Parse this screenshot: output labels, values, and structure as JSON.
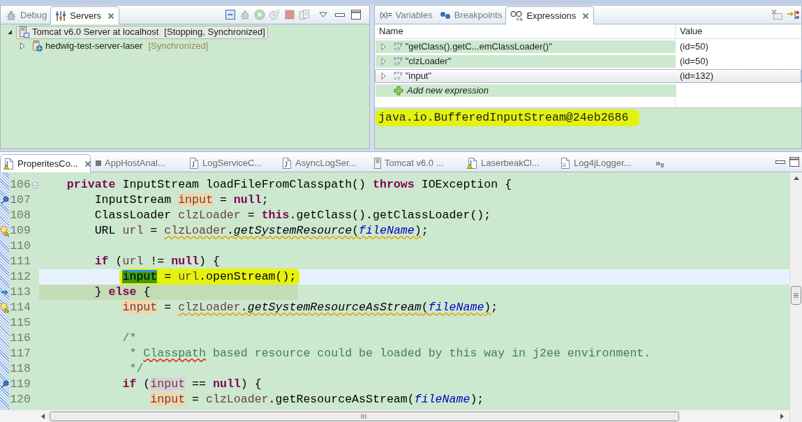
{
  "left_panel": {
    "tabs": [
      {
        "label": "Debug",
        "kind": "debug",
        "selected": false
      },
      {
        "label": "Servers",
        "kind": "servers",
        "selected": true
      }
    ],
    "toolbar": [
      {
        "kind": "collapse-all",
        "disabled": false
      },
      {
        "kind": "debug",
        "disabled": true
      },
      {
        "kind": "start",
        "disabled": true
      },
      {
        "kind": "profile",
        "disabled": true
      },
      {
        "kind": "stop",
        "disabled": true
      },
      {
        "kind": "publish",
        "disabled": true
      }
    ],
    "tree": [
      {
        "label": "Tomcat v6.0 Server at localhost",
        "status": "[Stopping, Synchronized]",
        "kind": "server",
        "expanded": true,
        "selected": true,
        "children": [
          {
            "label": "hedwig-test-server-laser",
            "status": "[Synchronized]",
            "kind": "module",
            "expanded": false,
            "selected": false
          }
        ]
      }
    ]
  },
  "right_panel": {
    "tabs": [
      {
        "label": "Variables",
        "kind": "variables",
        "symbol": "(x)=",
        "selected": false
      },
      {
        "label": "Breakpoints",
        "kind": "breakpoints",
        "selected": false
      },
      {
        "label": "Expressions",
        "kind": "expressions",
        "selected": true
      }
    ],
    "columns": [
      "Name",
      "Value"
    ],
    "expressions": [
      {
        "symbol": [
          "x+y",
          "=?"
        ],
        "expression": "\"getClass().getC...emClassLoader()\"",
        "value": "(id=50)",
        "selected": false
      },
      {
        "symbol": [
          "x+y",
          "=?"
        ],
        "expression": "\"clzLoader\"",
        "value": "(id=50)",
        "selected": false
      },
      {
        "symbol": [
          "x+y",
          "=?"
        ],
        "expression": "\"input\"",
        "value": "(id=132)",
        "selected": true
      }
    ],
    "add_expression": "Add new expression",
    "detail": {
      "text": "java.io.BufferedInputStream@24eb2686",
      "highlighter": true
    }
  },
  "editor": {
    "tabs": [
      {
        "label": "ProperitesCo...",
        "kind": "java-warning",
        "selected": true
      },
      {
        "label": "AppHostAnal...",
        "kind": "text",
        "selected": false
      },
      {
        "label": "LogServiceC...",
        "kind": "java",
        "selected": false
      },
      {
        "label": "AsyncLogSer...",
        "kind": "java",
        "selected": false
      },
      {
        "label": "Tomcat v6.0 ...",
        "kind": "server",
        "selected": false
      },
      {
        "label": "LaserbeakCl...",
        "kind": "java-warning",
        "selected": false
      },
      {
        "label": "Log4jLogger...",
        "kind": "class",
        "selected": false
      }
    ],
    "overflow": {
      "symbol": "»",
      "count": "8"
    },
    "lines": [
      {
        "number": "106",
        "kind": "plain",
        "fold": true,
        "current": false,
        "highlighted": false,
        "highlighter": false,
        "tokens": [
          {
            "text": "    private",
            "kind": "keyword"
          },
          {
            "text": " InputStream loadFileFromClasspath() ",
            "kind": "plain"
          },
          {
            "text": "throws",
            "kind": "keyword"
          },
          {
            "text": " IOException {",
            "kind": "plain"
          }
        ]
      },
      {
        "number": "107",
        "kind": "pin",
        "fold": false,
        "current": false,
        "highlighted": false,
        "highlighter": false,
        "tokens": [
          {
            "text": "        InputStream ",
            "kind": "plain"
          },
          {
            "text": "input",
            "kind": "write"
          },
          {
            "text": " = ",
            "kind": "plain"
          },
          {
            "text": "null",
            "kind": "keyword"
          },
          {
            "text": ";",
            "kind": "plain"
          }
        ]
      },
      {
        "number": "108",
        "kind": "plain",
        "fold": false,
        "current": false,
        "highlighted": false,
        "highlighter": false,
        "tokens": [
          {
            "text": "        ClassLoader ",
            "kind": "plain"
          },
          {
            "text": "clzLoader",
            "kind": "local"
          },
          {
            "text": " = ",
            "kind": "plain"
          },
          {
            "text": "this",
            "kind": "keyword"
          },
          {
            "text": ".getClass().getClassLoader();",
            "kind": "plain"
          }
        ]
      },
      {
        "number": "109",
        "kind": "warning",
        "fold": false,
        "current": false,
        "highlighted": false,
        "highlighter": false,
        "tokens": [
          {
            "text": "        URL ",
            "kind": "plain"
          },
          {
            "text": "url",
            "kind": "local"
          },
          {
            "text": " = ",
            "kind": "plain"
          },
          {
            "text": "clzLoader",
            "kind": "local",
            "warning": true
          },
          {
            "text": ".",
            "kind": "plain",
            "warning": true
          },
          {
            "text": "getSystemResource",
            "kind": "static",
            "warning": true
          },
          {
            "text": "(",
            "kind": "plain",
            "warning": true
          },
          {
            "text": "fileName",
            "kind": "field",
            "warning": true
          },
          {
            "text": ")",
            "kind": "plain",
            "warning": true
          },
          {
            "text": ";",
            "kind": "plain"
          }
        ]
      },
      {
        "number": "110",
        "kind": "plain",
        "fold": false,
        "current": false,
        "highlighted": false,
        "highlighter": false
      },
      {
        "number": "111",
        "kind": "plain",
        "fold": false,
        "current": false,
        "highlighted": false,
        "highlighter": false,
        "tokens": [
          {
            "text": "        if",
            "kind": "keyword"
          },
          {
            "text": " (",
            "kind": "plain"
          },
          {
            "text": "url",
            "kind": "local"
          },
          {
            "text": " != ",
            "kind": "plain"
          },
          {
            "text": "null",
            "kind": "keyword"
          },
          {
            "text": ") {",
            "kind": "plain"
          }
        ]
      },
      {
        "number": "112",
        "kind": "plain",
        "fold": false,
        "current": true,
        "highlighted": false,
        "highlighter": true,
        "tokens": [
          {
            "text": "            input",
            "kind": "selected"
          },
          {
            "text": " = ",
            "kind": "plain"
          },
          {
            "text": "url",
            "kind": "local"
          },
          {
            "text": ".openStream();",
            "kind": "plain"
          }
        ]
      },
      {
        "number": "113",
        "kind": "arrow",
        "fold": false,
        "current": false,
        "highlighted": true,
        "highlighter": false,
        "tokens": [
          {
            "text": "        } ",
            "kind": "plain"
          },
          {
            "text": "else",
            "kind": "keyword"
          },
          {
            "text": " {",
            "kind": "plain"
          }
        ]
      },
      {
        "number": "114",
        "kind": "warning",
        "fold": false,
        "current": false,
        "highlighted": false,
        "highlighter": false,
        "tokens": [
          {
            "text": "            input",
            "kind": "write"
          },
          {
            "text": " = ",
            "kind": "plain"
          },
          {
            "text": "clzLoader",
            "kind": "local",
            "warning": true
          },
          {
            "text": ".",
            "kind": "plain",
            "warning": true
          },
          {
            "text": "getSystemResourceAsStream",
            "kind": "static",
            "warning": true
          },
          {
            "text": "(",
            "kind": "plain",
            "warning": true
          },
          {
            "text": "fileName",
            "kind": "field",
            "warning": true
          },
          {
            "text": ")",
            "kind": "plain",
            "warning": true
          },
          {
            "text": ";",
            "kind": "plain"
          }
        ]
      },
      {
        "number": "115",
        "kind": "plain",
        "fold": false,
        "current": false,
        "highlighted": false,
        "highlighter": false
      },
      {
        "number": "116",
        "kind": "plain",
        "fold": false,
        "current": false,
        "highlighted": false,
        "highlighter": false,
        "tokens": [
          {
            "text": "            /*",
            "kind": "comment"
          }
        ]
      },
      {
        "number": "117",
        "kind": "plain",
        "fold": false,
        "current": false,
        "highlighted": false,
        "highlighter": false,
        "tokens": [
          {
            "text": "             * ",
            "kind": "comment"
          },
          {
            "text": "Classpath",
            "kind": "comment",
            "misspelled": true
          },
          {
            "text": " based resource could be loaded by this way in j2ee environment.",
            "kind": "comment"
          }
        ]
      },
      {
        "number": "118",
        "kind": "plain",
        "fold": false,
        "current": false,
        "highlighted": false,
        "highlighter": false,
        "tokens": [
          {
            "text": "             */",
            "kind": "comment"
          }
        ]
      },
      {
        "number": "119",
        "kind": "pin",
        "fold": false,
        "current": false,
        "highlighted": false,
        "highlighter": false,
        "tokens": [
          {
            "text": "            if",
            "kind": "keyword"
          },
          {
            "text": " (",
            "kind": "plain"
          },
          {
            "text": "input",
            "kind": "read"
          },
          {
            "text": " == ",
            "kind": "plain"
          },
          {
            "text": "null",
            "kind": "keyword"
          },
          {
            "text": ") {",
            "kind": "plain"
          }
        ]
      },
      {
        "number": "120",
        "kind": "plain",
        "fold": false,
        "current": false,
        "highlighted": false,
        "highlighter": false,
        "tokens": [
          {
            "text": "                input",
            "kind": "write"
          },
          {
            "text": " = ",
            "kind": "plain"
          },
          {
            "text": "clzLoader",
            "kind": "local"
          },
          {
            "text": ".getResourceAsStream(",
            "kind": "plain"
          },
          {
            "text": "fileName",
            "kind": "field"
          },
          {
            "text": ");",
            "kind": "plain"
          }
        ]
      }
    ]
  }
}
